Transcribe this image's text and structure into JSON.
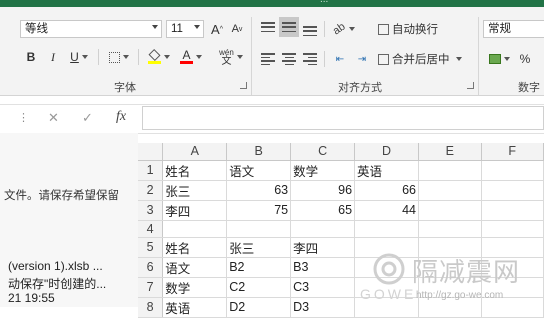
{
  "ribbon": {
    "title_fragment": "...",
    "font": {
      "name": "等线",
      "size": "11",
      "grow_label": "A",
      "shrink_label": "A",
      "bold": "B",
      "italic": "I",
      "underline": "U",
      "font_color_letter": "A",
      "phonetic_top": "wén",
      "phonetic_bottom": "文",
      "group_label": "字体"
    },
    "alignment": {
      "wrap_text": "自动换行",
      "merge_center": "合并后居中",
      "group_label": "对齐方式"
    },
    "number": {
      "format": "常规",
      "percent": "%",
      "group_label": "数字"
    },
    "colors": {
      "accent": "#217346",
      "highlight": "#ffff00",
      "font_color": "#ff0000"
    }
  },
  "formula_bar": {
    "cancel": "✕",
    "enter": "✓",
    "fx": "fx",
    "value": ""
  },
  "left_panel": {
    "message": "文件。请保存希望保留",
    "files": [
      {
        "name": "(version 1).xlsb ...",
        "desc": "动保存\"时创建的...",
        "time": "21 19:55"
      }
    ]
  },
  "sheet": {
    "columns": [
      "A",
      "B",
      "C",
      "D",
      "E",
      "F"
    ],
    "rows": [
      {
        "num": "1",
        "cells": [
          "姓名",
          "语文",
          "数学",
          "英语",
          "",
          ""
        ]
      },
      {
        "num": "2",
        "cells": [
          "张三",
          "63",
          "96",
          "66",
          "",
          ""
        ]
      },
      {
        "num": "3",
        "cells": [
          "李四",
          "75",
          "65",
          "44",
          "",
          ""
        ]
      },
      {
        "num": "4",
        "cells": [
          "",
          "",
          "",
          "",
          "",
          ""
        ]
      },
      {
        "num": "5",
        "cells": [
          "姓名",
          "张三",
          "李四",
          "",
          "",
          ""
        ]
      },
      {
        "num": "6",
        "cells": [
          "语文",
          "B2",
          "B3",
          "",
          "",
          ""
        ]
      },
      {
        "num": "7",
        "cells": [
          "数学",
          "C2",
          "C3",
          "",
          "",
          ""
        ]
      },
      {
        "num": "8",
        "cells": [
          "英语",
          "D2",
          "D3",
          "",
          "",
          ""
        ]
      }
    ]
  },
  "watermark": {
    "brand": "隔减震网",
    "latin": "GOWE",
    "url": "http://gz.go-we.com"
  }
}
